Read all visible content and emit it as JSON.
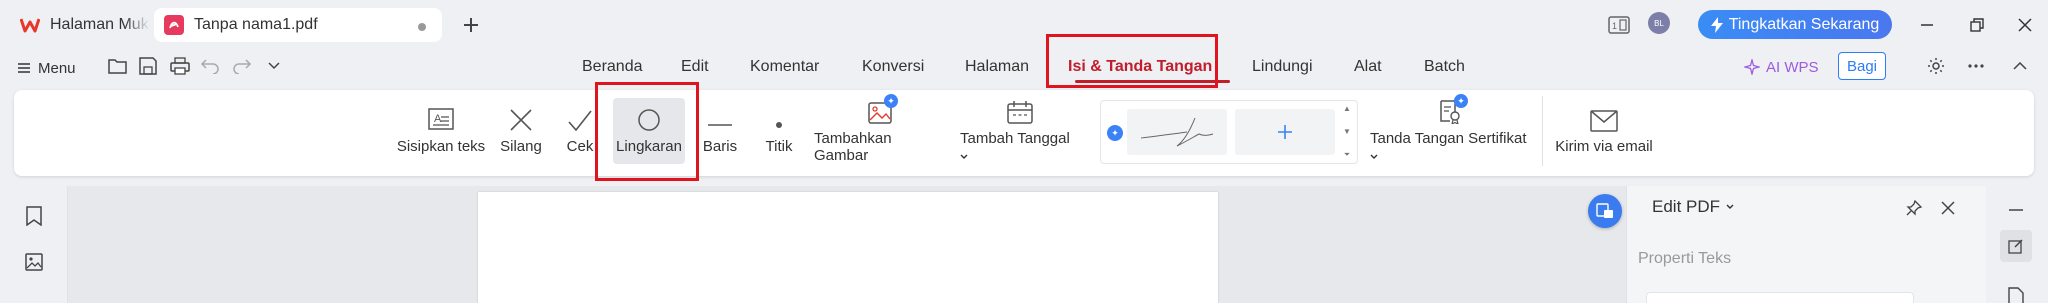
{
  "titlebar": {
    "tabs": [
      {
        "label": "Halaman Muka",
        "icon": "wps-logo-icon"
      },
      {
        "label": "Tanpa nama1.pdf",
        "icon": "pdf-icon"
      }
    ],
    "new_tab_icon": "plus-icon",
    "avatar_text": "BL",
    "upgrade_label": "Tingkatkan Sekarang"
  },
  "menubar": {
    "menu_label": "Menu",
    "tabs": [
      "Beranda",
      "Edit",
      "Komentar",
      "Konversi",
      "Halaman",
      "Isi & Tanda Tangan",
      "Lindungi",
      "Alat",
      "Batch"
    ],
    "active_tab": "Isi & Tanda Tangan",
    "ai_label": "AI WPS",
    "share_label": "Bagi"
  },
  "ribbon": {
    "tools": [
      {
        "label": "Sisipkan teks",
        "icon": "text-box-icon"
      },
      {
        "label": "Silang",
        "icon": "cross-icon"
      },
      {
        "label": "Cek",
        "icon": "check-icon"
      },
      {
        "label": "Lingkaran",
        "icon": "circle-icon"
      },
      {
        "label": "Baris",
        "icon": "line-icon"
      },
      {
        "label": "Titik",
        "icon": "dot-icon"
      },
      {
        "label": "Tambahkan Gambar",
        "icon": "image-icon"
      },
      {
        "label": "Tambah Tanggal",
        "icon": "calendar-icon"
      },
      {
        "label": "Tanda Tangan Sertifikat",
        "icon": "certificate-icon"
      },
      {
        "label": "Kirim via email",
        "icon": "email-icon"
      }
    ],
    "selected_tool": "Lingkaran",
    "signature_add_icon": "plus-icon"
  },
  "side_panel": {
    "title": "Edit PDF",
    "subtitle": "Properti Teks"
  },
  "colors": {
    "accent_red": "#c21d2b",
    "highlight_red": "#e0141e",
    "upgrade_blue": "#3a8cf5",
    "share_blue": "#2d7df4",
    "ai_purple": "#9d5be0"
  }
}
